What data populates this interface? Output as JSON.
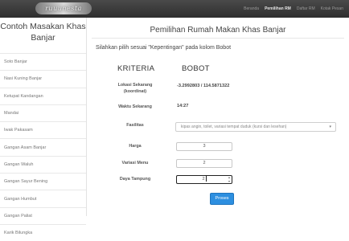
{
  "header": {
    "logo_text": "ruuunesta",
    "nav": [
      "Beranda",
      "Pemilihan RM",
      "Daftar RM",
      "Kotak Pesan"
    ]
  },
  "sidebar": {
    "title": "Contoh Masakan Khas Banjar",
    "items": [
      "Soto Banjar",
      "Nasi Kuning Banjar",
      "Ketupat Kandangan",
      "Mandai",
      "Iwak Pakasam",
      "Gangan Asam Banjar",
      "Gangan Waluh",
      "Gangan Sayur Bening",
      "Gangan Humbut",
      "Gangan Paliat",
      "Karik Bilungka"
    ]
  },
  "main": {
    "title": "Pemilihan Rumah Makan Khas Banjar",
    "instruction": "Silahkan pilih sesuai \"Kepentingan\" pada kolom Bobot",
    "col_kriteria": "KRITERIA",
    "col_bobot": "BOBOT",
    "lokasi_label": "Lokasi Sekarang (koordinat)",
    "lokasi_value": "-3.2992803 / 114.5871322",
    "waktu_label": "Waktu Sekarang",
    "waktu_value": "14:27",
    "fasilitas_label": "Fasilitas",
    "fasilitas_value": "kipas angin, toilet, variasi tempat duduk (kursi dan lesehan)",
    "harga_label": "Harga",
    "harga_value": "3",
    "variasi_label": "Variasi Menu",
    "variasi_value": "2",
    "daya_label": "Daya Tampung",
    "daya_value": "2",
    "submit_label": "Proses"
  }
}
